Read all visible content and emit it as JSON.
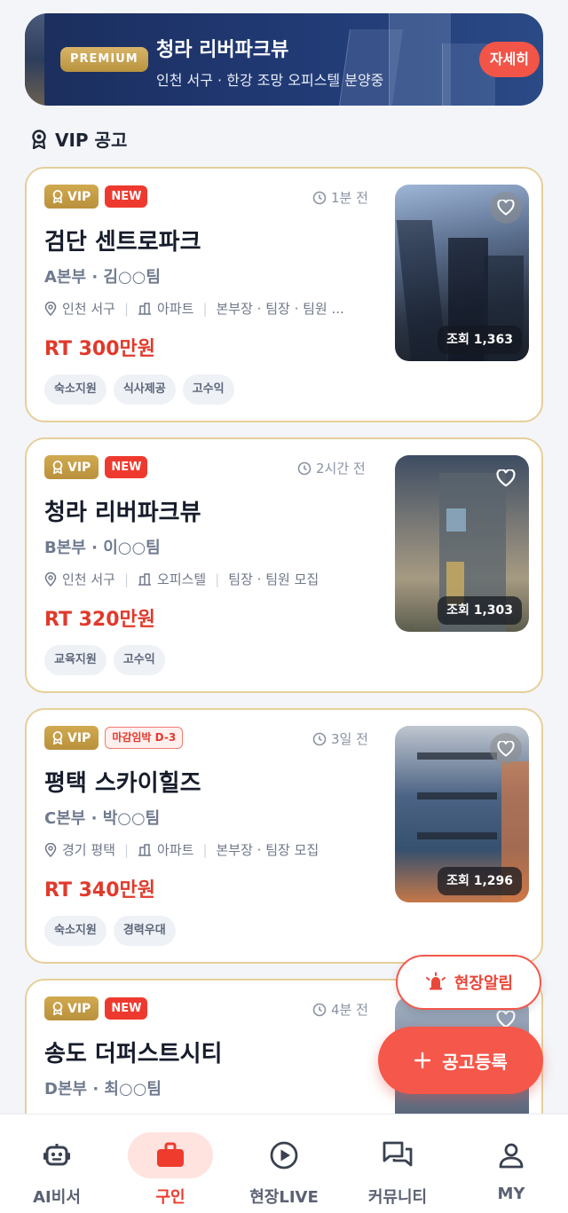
{
  "banner": {
    "badge": "PREMIUM",
    "title": "청라 리버파크뷰",
    "subtitle": "인천 서구 · 한강 조망 오피스텔 분양중",
    "button": "자세히"
  },
  "section": {
    "title": "VIP 공고",
    "icon": "award-icon"
  },
  "cards": [
    {
      "vip": "VIP",
      "badge": "NEW",
      "time": "1분 전",
      "title": "검단 센트로파크",
      "team": "A본부 · 김○○팀",
      "location": "인천 서구",
      "type": "아파트",
      "roles": "본부장 · 팀장 · 팀원 ...",
      "pay": "RT 300만원",
      "tags": [
        "숙소지원",
        "식사제공",
        "고수익"
      ],
      "views": "조회 1,363"
    },
    {
      "vip": "VIP",
      "badge": "NEW",
      "time": "2시간 전",
      "title": "청라 리버파크뷰",
      "team": "B본부 · 이○○팀",
      "location": "인천 서구",
      "type": "오피스텔",
      "roles": "팀장 · 팀원 모집",
      "pay": "RT 320만원",
      "tags": [
        "교육지원",
        "고수익"
      ],
      "views": "조회 1,303"
    },
    {
      "vip": "VIP",
      "badge": "마감임박 D-3",
      "time": "3일 전",
      "title": "평택 스카이힐즈",
      "team": "C본부 · 박○○팀",
      "location": "경기 평택",
      "type": "아파트",
      "roles": "본부장 · 팀장 모집",
      "pay": "RT 340만원",
      "tags": [
        "숙소지원",
        "경력우대"
      ],
      "views": "조회 1,296"
    },
    {
      "vip": "VIP",
      "badge": "NEW",
      "time": "4분 전",
      "title": "송도 더퍼스트시티",
      "team": "D본부 · 최○○팀"
    }
  ],
  "fab": {
    "alert": "현장알림",
    "register": "공고등록"
  },
  "nav": [
    {
      "label": "AI비서",
      "icon": "robot-icon",
      "active": false
    },
    {
      "label": "구인",
      "icon": "briefcase-icon",
      "active": true
    },
    {
      "label": "현장LIVE",
      "icon": "play-icon",
      "active": false
    },
    {
      "label": "커뮤니티",
      "icon": "chat-icon",
      "active": false
    },
    {
      "label": "MY",
      "icon": "user-icon",
      "active": false
    }
  ],
  "colors": {
    "accent": "#ee3b2e",
    "vip_gold": "#c9a24a",
    "banner_navy": "#1f3570"
  }
}
